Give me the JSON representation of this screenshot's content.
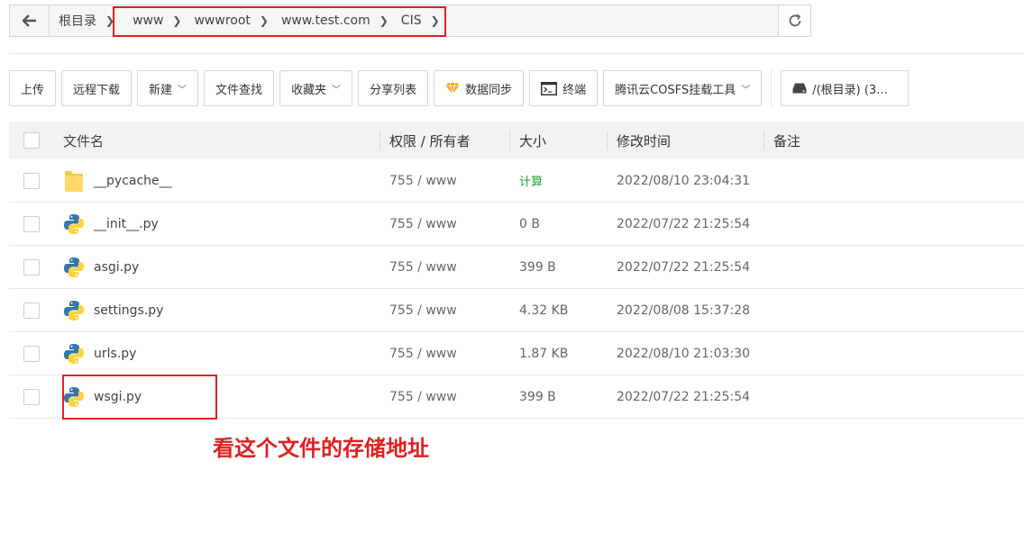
{
  "breadcrumb": {
    "root": "根目录",
    "items": [
      "www",
      "wwwroot",
      "www.test.com",
      "CIS"
    ]
  },
  "toolbar": {
    "upload": "上传",
    "remote_download": "远程下载",
    "new": "新建",
    "file_search": "文件查找",
    "favorites": "收藏夹",
    "share_list": "分享列表",
    "data_sync": "数据同步",
    "terminal": "终端",
    "cosfs": "腾讯云COSFS挂载工具",
    "disk": "/(根目录) (3..."
  },
  "table": {
    "headers": {
      "name": "文件名",
      "perm": "权限 / 所有者",
      "size": "大小",
      "time": "修改时间",
      "note": "备注"
    },
    "rows": [
      {
        "name": "__pycache__",
        "type": "folder",
        "perm": "755 / www",
        "size": "计算",
        "time": "2022/08/10 23:04:31"
      },
      {
        "name": "__init__.py",
        "type": "python",
        "perm": "755 / www",
        "size": "0 B",
        "time": "2022/07/22 21:25:54"
      },
      {
        "name": "asgi.py",
        "type": "python",
        "perm": "755 / www",
        "size": "399 B",
        "time": "2022/07/22 21:25:54"
      },
      {
        "name": "settings.py",
        "type": "python",
        "perm": "755 / www",
        "size": "4.32 KB",
        "time": "2022/08/08 15:37:28"
      },
      {
        "name": "urls.py",
        "type": "python",
        "perm": "755 / www",
        "size": "1.87 KB",
        "time": "2022/08/10 21:03:30"
      },
      {
        "name": "wsgi.py",
        "type": "python",
        "perm": "755 / www",
        "size": "399 B",
        "time": "2022/07/22 21:25:54"
      }
    ]
  },
  "annotation": "看这个文件的存储地址",
  "colors": {
    "highlight": "#e02020",
    "calc_green": "#20a53a"
  }
}
